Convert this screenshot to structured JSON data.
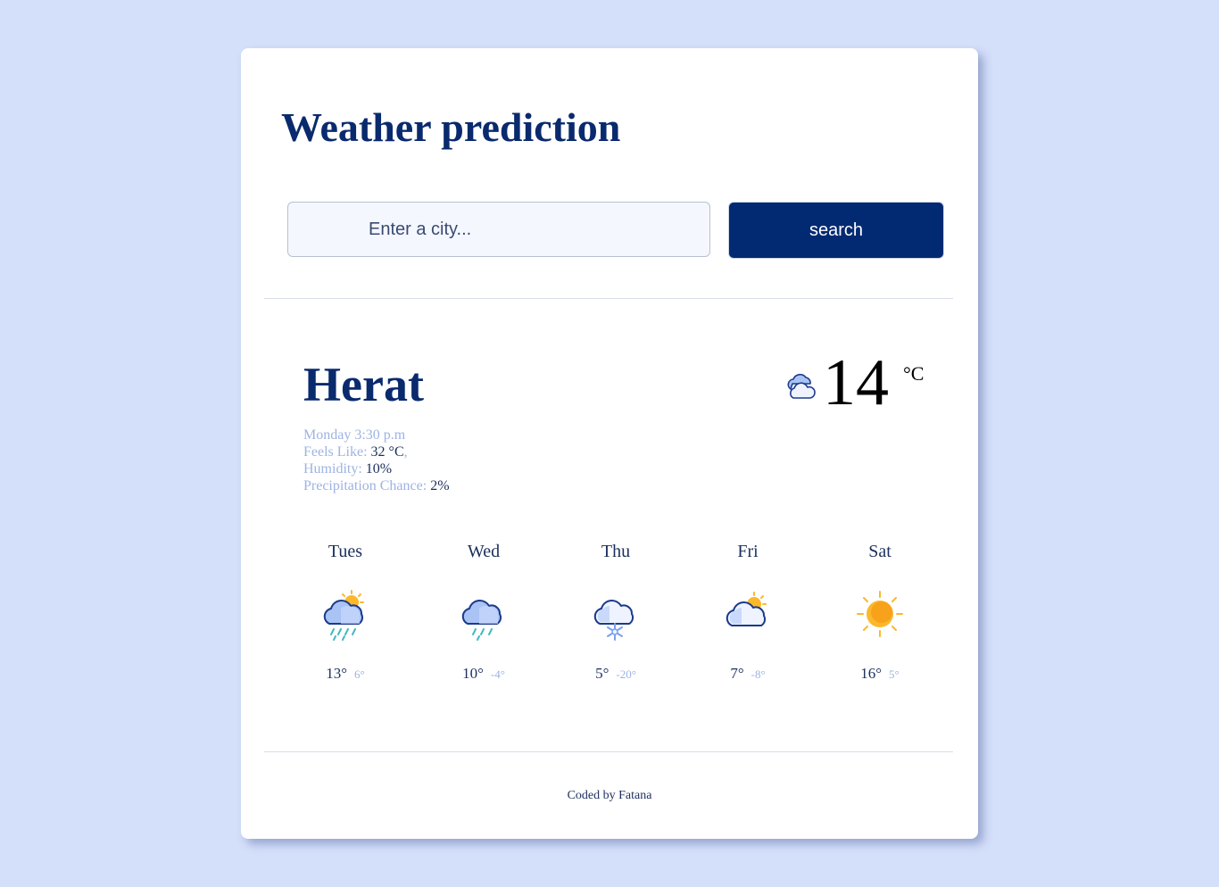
{
  "header": {
    "title": "Weather prediction"
  },
  "search": {
    "placeholder": "Enter a city...",
    "value": "",
    "button_label": "search"
  },
  "current": {
    "city": "Herat",
    "datetime": "Monday 3:30 p.m",
    "feels_like_label": "Feels Like:",
    "feels_like_value": "32 °C",
    "humidity_label": "Humidity:",
    "humidity_value": "10%",
    "precipitation_label": "Precipitation Chance:",
    "precipitation_value": "2%",
    "temperature": "14",
    "unit": "°C",
    "icon": "few-clouds-icon"
  },
  "forecast": [
    {
      "day": "Tues",
      "max": "13°",
      "min": "6°",
      "icon": "rain-sun-icon"
    },
    {
      "day": "Wed",
      "max": "10°",
      "min": "-4°",
      "icon": "rain-icon"
    },
    {
      "day": "Thu",
      "max": "5°",
      "min": "-20°",
      "icon": "snow-icon"
    },
    {
      "day": "Fri",
      "max": "7°",
      "min": "-8°",
      "icon": "partly-cloudy-icon"
    },
    {
      "day": "Sat",
      "max": "16°",
      "min": "5°",
      "icon": "sun-icon"
    }
  ],
  "footer": {
    "text": "Coded by Fatana"
  },
  "colors": {
    "background": "#d4dffa",
    "primary": "#0a2a6e",
    "button": "#022a72",
    "muted": "#9db3e3"
  }
}
